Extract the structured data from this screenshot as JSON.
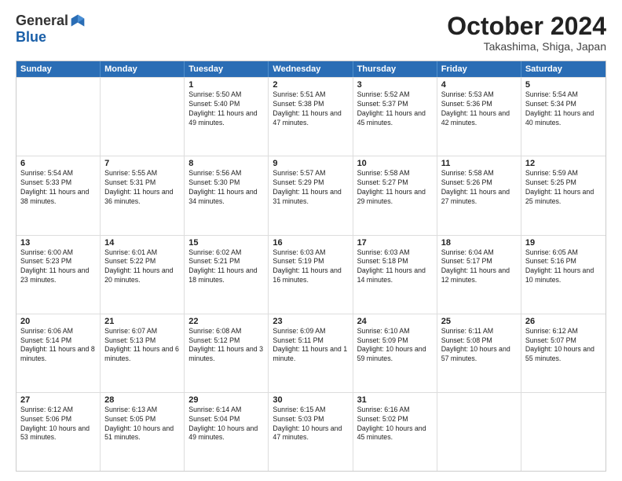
{
  "logo": {
    "general": "General",
    "blue": "Blue"
  },
  "title": "October 2024",
  "subtitle": "Takashima, Shiga, Japan",
  "weekdays": [
    "Sunday",
    "Monday",
    "Tuesday",
    "Wednesday",
    "Thursday",
    "Friday",
    "Saturday"
  ],
  "weeks": [
    [
      {
        "day": "",
        "info": ""
      },
      {
        "day": "",
        "info": ""
      },
      {
        "day": "1",
        "info": "Sunrise: 5:50 AM\nSunset: 5:40 PM\nDaylight: 11 hours and 49 minutes."
      },
      {
        "day": "2",
        "info": "Sunrise: 5:51 AM\nSunset: 5:38 PM\nDaylight: 11 hours and 47 minutes."
      },
      {
        "day": "3",
        "info": "Sunrise: 5:52 AM\nSunset: 5:37 PM\nDaylight: 11 hours and 45 minutes."
      },
      {
        "day": "4",
        "info": "Sunrise: 5:53 AM\nSunset: 5:36 PM\nDaylight: 11 hours and 42 minutes."
      },
      {
        "day": "5",
        "info": "Sunrise: 5:54 AM\nSunset: 5:34 PM\nDaylight: 11 hours and 40 minutes."
      }
    ],
    [
      {
        "day": "6",
        "info": "Sunrise: 5:54 AM\nSunset: 5:33 PM\nDaylight: 11 hours and 38 minutes."
      },
      {
        "day": "7",
        "info": "Sunrise: 5:55 AM\nSunset: 5:31 PM\nDaylight: 11 hours and 36 minutes."
      },
      {
        "day": "8",
        "info": "Sunrise: 5:56 AM\nSunset: 5:30 PM\nDaylight: 11 hours and 34 minutes."
      },
      {
        "day": "9",
        "info": "Sunrise: 5:57 AM\nSunset: 5:29 PM\nDaylight: 11 hours and 31 minutes."
      },
      {
        "day": "10",
        "info": "Sunrise: 5:58 AM\nSunset: 5:27 PM\nDaylight: 11 hours and 29 minutes."
      },
      {
        "day": "11",
        "info": "Sunrise: 5:58 AM\nSunset: 5:26 PM\nDaylight: 11 hours and 27 minutes."
      },
      {
        "day": "12",
        "info": "Sunrise: 5:59 AM\nSunset: 5:25 PM\nDaylight: 11 hours and 25 minutes."
      }
    ],
    [
      {
        "day": "13",
        "info": "Sunrise: 6:00 AM\nSunset: 5:23 PM\nDaylight: 11 hours and 23 minutes."
      },
      {
        "day": "14",
        "info": "Sunrise: 6:01 AM\nSunset: 5:22 PM\nDaylight: 11 hours and 20 minutes."
      },
      {
        "day": "15",
        "info": "Sunrise: 6:02 AM\nSunset: 5:21 PM\nDaylight: 11 hours and 18 minutes."
      },
      {
        "day": "16",
        "info": "Sunrise: 6:03 AM\nSunset: 5:19 PM\nDaylight: 11 hours and 16 minutes."
      },
      {
        "day": "17",
        "info": "Sunrise: 6:03 AM\nSunset: 5:18 PM\nDaylight: 11 hours and 14 minutes."
      },
      {
        "day": "18",
        "info": "Sunrise: 6:04 AM\nSunset: 5:17 PM\nDaylight: 11 hours and 12 minutes."
      },
      {
        "day": "19",
        "info": "Sunrise: 6:05 AM\nSunset: 5:16 PM\nDaylight: 11 hours and 10 minutes."
      }
    ],
    [
      {
        "day": "20",
        "info": "Sunrise: 6:06 AM\nSunset: 5:14 PM\nDaylight: 11 hours and 8 minutes."
      },
      {
        "day": "21",
        "info": "Sunrise: 6:07 AM\nSunset: 5:13 PM\nDaylight: 11 hours and 6 minutes."
      },
      {
        "day": "22",
        "info": "Sunrise: 6:08 AM\nSunset: 5:12 PM\nDaylight: 11 hours and 3 minutes."
      },
      {
        "day": "23",
        "info": "Sunrise: 6:09 AM\nSunset: 5:11 PM\nDaylight: 11 hours and 1 minute."
      },
      {
        "day": "24",
        "info": "Sunrise: 6:10 AM\nSunset: 5:09 PM\nDaylight: 10 hours and 59 minutes."
      },
      {
        "day": "25",
        "info": "Sunrise: 6:11 AM\nSunset: 5:08 PM\nDaylight: 10 hours and 57 minutes."
      },
      {
        "day": "26",
        "info": "Sunrise: 6:12 AM\nSunset: 5:07 PM\nDaylight: 10 hours and 55 minutes."
      }
    ],
    [
      {
        "day": "27",
        "info": "Sunrise: 6:12 AM\nSunset: 5:06 PM\nDaylight: 10 hours and 53 minutes."
      },
      {
        "day": "28",
        "info": "Sunrise: 6:13 AM\nSunset: 5:05 PM\nDaylight: 10 hours and 51 minutes."
      },
      {
        "day": "29",
        "info": "Sunrise: 6:14 AM\nSunset: 5:04 PM\nDaylight: 10 hours and 49 minutes."
      },
      {
        "day": "30",
        "info": "Sunrise: 6:15 AM\nSunset: 5:03 PM\nDaylight: 10 hours and 47 minutes."
      },
      {
        "day": "31",
        "info": "Sunrise: 6:16 AM\nSunset: 5:02 PM\nDaylight: 10 hours and 45 minutes."
      },
      {
        "day": "",
        "info": ""
      },
      {
        "day": "",
        "info": ""
      }
    ]
  ]
}
